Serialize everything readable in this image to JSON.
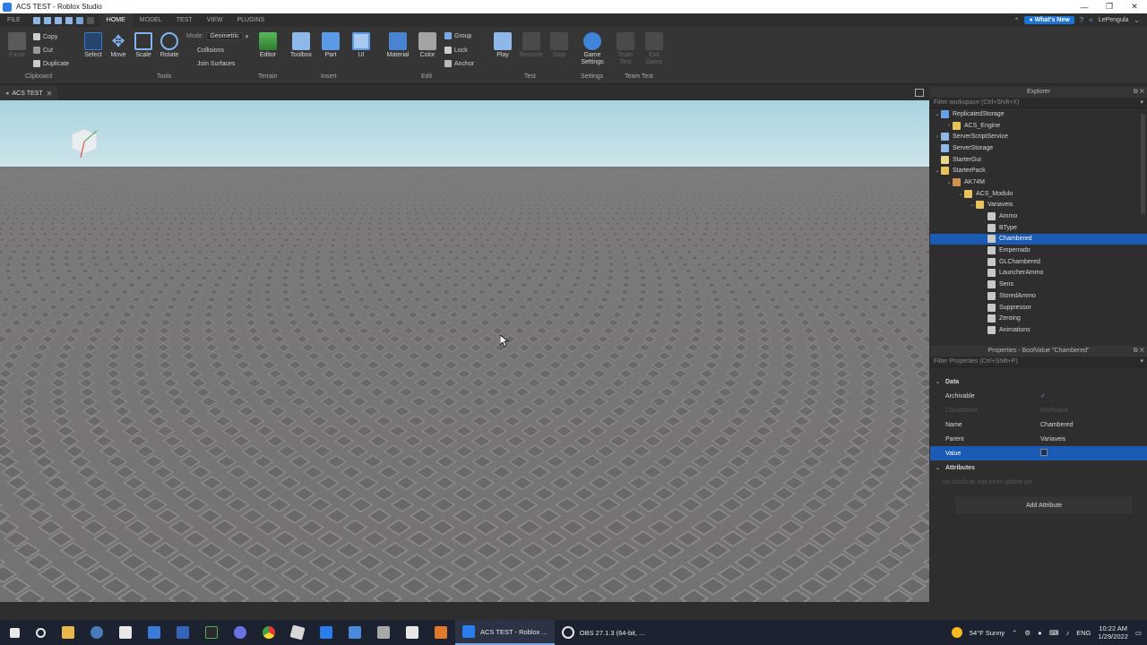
{
  "window": {
    "title": "ACS TEST - Roblox Studio"
  },
  "menu": {
    "file": "FILE",
    "tabs": [
      "HOME",
      "MODEL",
      "TEST",
      "VIEW",
      "PLUGINS"
    ],
    "whats_new": "What's New",
    "user": "LePengula"
  },
  "ribbon": {
    "clipboard": {
      "paste": "Paste",
      "copy": "Copy",
      "cut": "Cut",
      "duplicate": "Duplicate",
      "label": "Clipboard"
    },
    "tools": {
      "select": "Select",
      "move": "Move",
      "scale": "Scale",
      "rotate": "Rotate",
      "mode_label": "Mode:",
      "mode_value": "Geometric",
      "collisions": "Collisions",
      "join_surfaces": "Join Surfaces",
      "label": "Tools"
    },
    "terrain": {
      "editor": "Editor",
      "label": "Terrain"
    },
    "insert": {
      "toolbox": "Toolbox",
      "part": "Part",
      "ui": "UI",
      "label": "Insert"
    },
    "edit": {
      "material": "Material",
      "color": "Color",
      "group": "Group",
      "lock": "Lock",
      "anchor": "Anchor",
      "label": "Edit"
    },
    "test": {
      "play": "Play",
      "resume": "Resume",
      "stop": "Stop",
      "label": "Test"
    },
    "settings": {
      "game_settings_1": "Game",
      "game_settings_2": "Settings",
      "label": "Settings"
    },
    "team_test": {
      "team_test_1": "Team",
      "team_test_2": "Test",
      "exit_game_1": "Exit",
      "exit_game_2": "Game",
      "label": "Team Test"
    }
  },
  "doc_tab": {
    "label": "ACS TEST"
  },
  "explorer": {
    "title": "Explorer",
    "filter_placeholder": "Filter workspace (Ctrl+Shift+X)",
    "nodes": [
      {
        "label": "ReplicatedStorage",
        "depth": 0,
        "arrow": "⌄",
        "color": "#6aa0e8"
      },
      {
        "label": "ACS_Engine",
        "depth": 1,
        "arrow": "›",
        "color": "#e8c25a"
      },
      {
        "label": "ServerScriptService",
        "depth": 0,
        "arrow": "›",
        "color": "#8fb8e8"
      },
      {
        "label": "ServerStorage",
        "depth": 0,
        "arrow": "",
        "color": "#8fb8e8"
      },
      {
        "label": "StarterGui",
        "depth": 0,
        "arrow": "",
        "color": "#e8d88a"
      },
      {
        "label": "StarterPack",
        "depth": 0,
        "arrow": "⌄",
        "color": "#e8c25a"
      },
      {
        "label": "AK74M",
        "depth": 1,
        "arrow": "⌄",
        "color": "#d09050"
      },
      {
        "label": "ACS_Modulo",
        "depth": 2,
        "arrow": "⌄",
        "color": "#e8c25a"
      },
      {
        "label": "Variaveis",
        "depth": 3,
        "arrow": "⌄",
        "color": "#e8c25a"
      },
      {
        "label": "Ammo",
        "depth": 4,
        "arrow": "",
        "color": "#c8c8c8"
      },
      {
        "label": "BType",
        "depth": 4,
        "arrow": "",
        "color": "#c8c8c8"
      },
      {
        "label": "Chambered",
        "depth": 4,
        "arrow": "",
        "color": "#c8c8c8",
        "selected": true
      },
      {
        "label": "Emperrado",
        "depth": 4,
        "arrow": "",
        "color": "#c8c8c8"
      },
      {
        "label": "GLChambered",
        "depth": 4,
        "arrow": "",
        "color": "#c8c8c8"
      },
      {
        "label": "LauncherAmmo",
        "depth": 4,
        "arrow": "",
        "color": "#c8c8c8"
      },
      {
        "label": "Sens",
        "depth": 4,
        "arrow": "",
        "color": "#c8c8c8"
      },
      {
        "label": "StoredAmmo",
        "depth": 4,
        "arrow": "",
        "color": "#c8c8c8"
      },
      {
        "label": "Suppressor",
        "depth": 4,
        "arrow": "",
        "color": "#c8c8c8"
      },
      {
        "label": "Zeroing",
        "depth": 4,
        "arrow": "",
        "color": "#c8c8c8"
      },
      {
        "label": "Animations",
        "depth": 4,
        "arrow": "",
        "color": "#c8c8c8"
      }
    ]
  },
  "properties": {
    "title": "Properties - BoolValue \"Chambered\"",
    "filter_placeholder": "Filter Properties (Ctrl+Shift+P)",
    "data_label": "Data",
    "archivable_label": "Archivable",
    "archivable_value": "✓",
    "classname_label": "ClassName",
    "classname_value": "BoolValue",
    "name_label": "Name",
    "name_value": "Chambered",
    "parent_label": "Parent",
    "parent_value": "Variaveis",
    "value_label": "Value",
    "attributes_label": "Attributes",
    "no_attr": "No Attribute has been added yet",
    "add_attr": "Add Attribute"
  },
  "taskbar": {
    "app1": "ACS TEST - Roblox ...",
    "app2": "OBS 27.1.3 (64-bit, ...",
    "weather": "54°F  Sunny",
    "lang": "ENG",
    "time": "10:22 AM",
    "date": "1/29/2022"
  }
}
